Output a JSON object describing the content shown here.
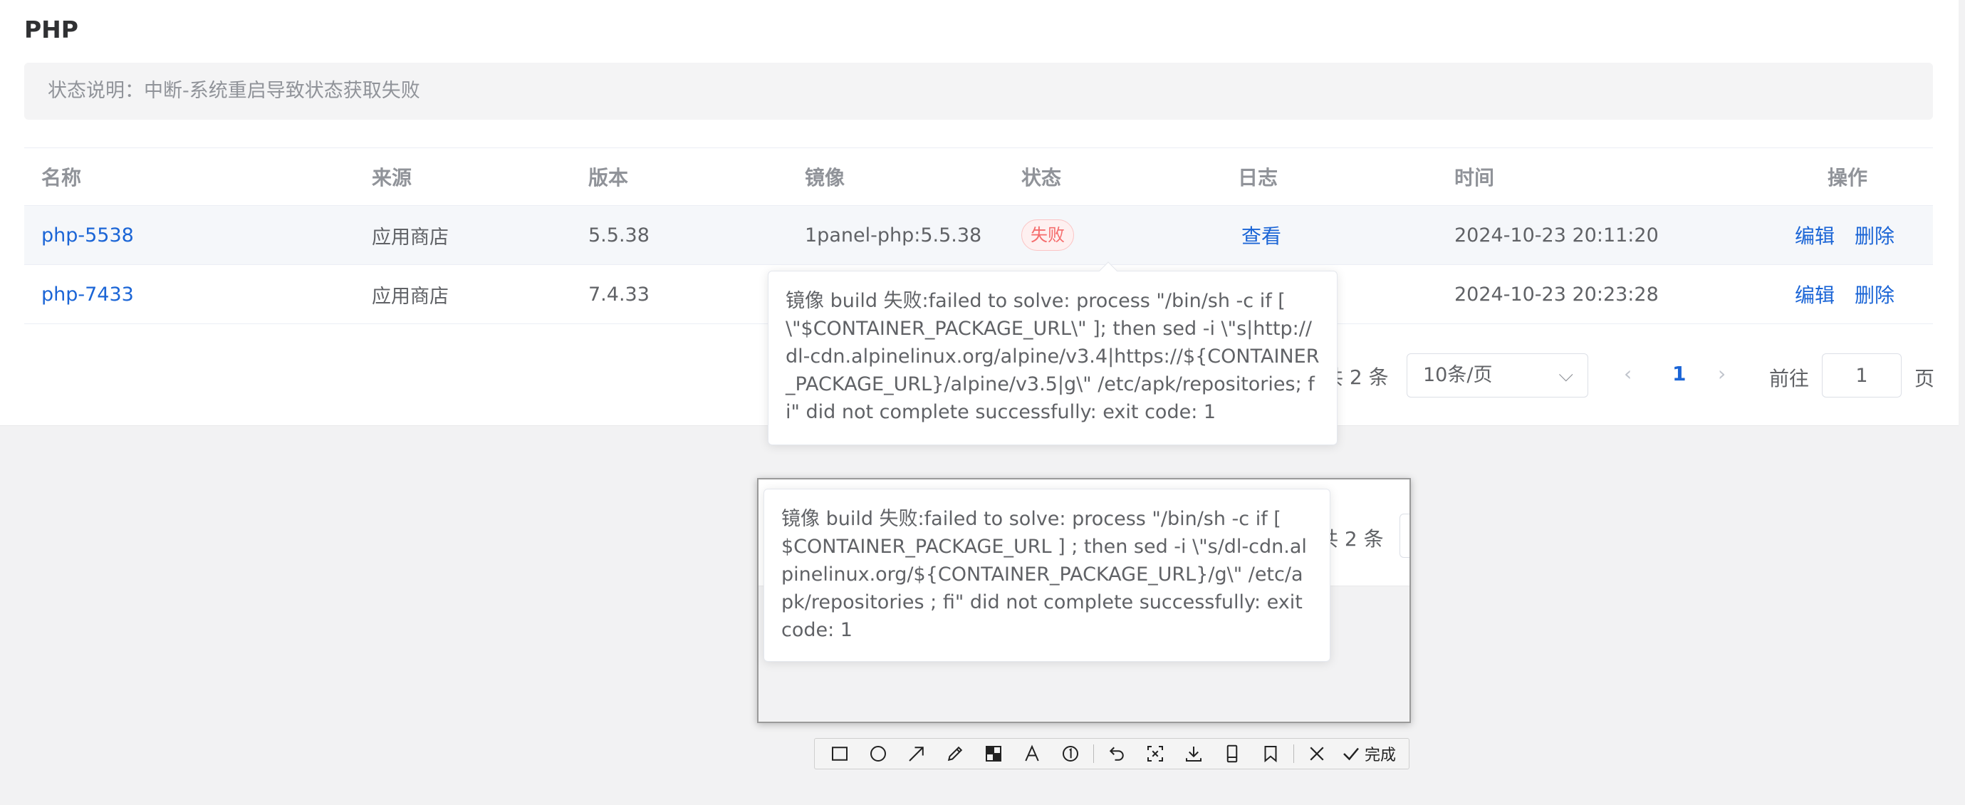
{
  "page": {
    "title": "PHP",
    "status_note": "状态说明：中断-系统重启导致状态获取失败"
  },
  "table": {
    "headers": [
      "名称",
      "来源",
      "版本",
      "镜像",
      "状态",
      "日志",
      "时间",
      "操作"
    ],
    "rows": [
      {
        "name": "php-5538",
        "source": "应用商店",
        "version": "5.5.38",
        "image": "1panel-php:5.5.38",
        "status": "失败",
        "log": "查看",
        "time": "2024-10-23 20:11:20",
        "edit": "编辑",
        "delete": "删除"
      },
      {
        "name": "php-7433",
        "source": "应用商店",
        "version": "7.4.33",
        "time": "2024-10-23 20:23:28",
        "edit": "编辑",
        "delete": "删除"
      }
    ]
  },
  "pagination": {
    "total": "共 2 条",
    "page_size": "10条/页",
    "current_page": "1",
    "goto_label": "前往",
    "goto_value": "1",
    "page_unit": "页"
  },
  "tooltips": {
    "error_5538": "镜像 build 失败:failed to solve: process \"/bin/sh -c if [ \\\"$CONTAINER_PACKAGE_URL\\\" ]; then sed -i \\\"s|http://dl-cdn.alpinelinux.org/alpine/v3.4|https://${CONTAINER_PACKAGE_URL}/alpine/v3.5|g\\\" /etc/apk/repositories; fi\" did not complete successfully: exit code: 1",
    "error_7433": "镜像 build 失败:failed to solve: process \"/bin/sh -c if [ $CONTAINER_PACKAGE_URL ] ; then sed -i \\\"s/dl-cdn.alpinelinux.org/${CONTAINER_PACKAGE_URL}/g\\\" /etc/apk/repositories ; fi\" did not complete successfully: exit code: 1"
  },
  "screenshot_overlay": {
    "partial_total": "共 2 条",
    "toolbar": {
      "tools": [
        "rectangle-tool",
        "ellipse-tool",
        "arrow-tool",
        "pen-tool",
        "mosaic-tool",
        "text-tool",
        "number-tool",
        "undo-tool",
        "pin-tool",
        "save-tool",
        "long-screenshot-tool",
        "bookmark-tool",
        "close-tool"
      ],
      "done_label": "完成"
    }
  },
  "colors": {
    "link": "#1b65d6",
    "danger": "#f56c6c",
    "text": "#606266",
    "muted": "#909399"
  }
}
